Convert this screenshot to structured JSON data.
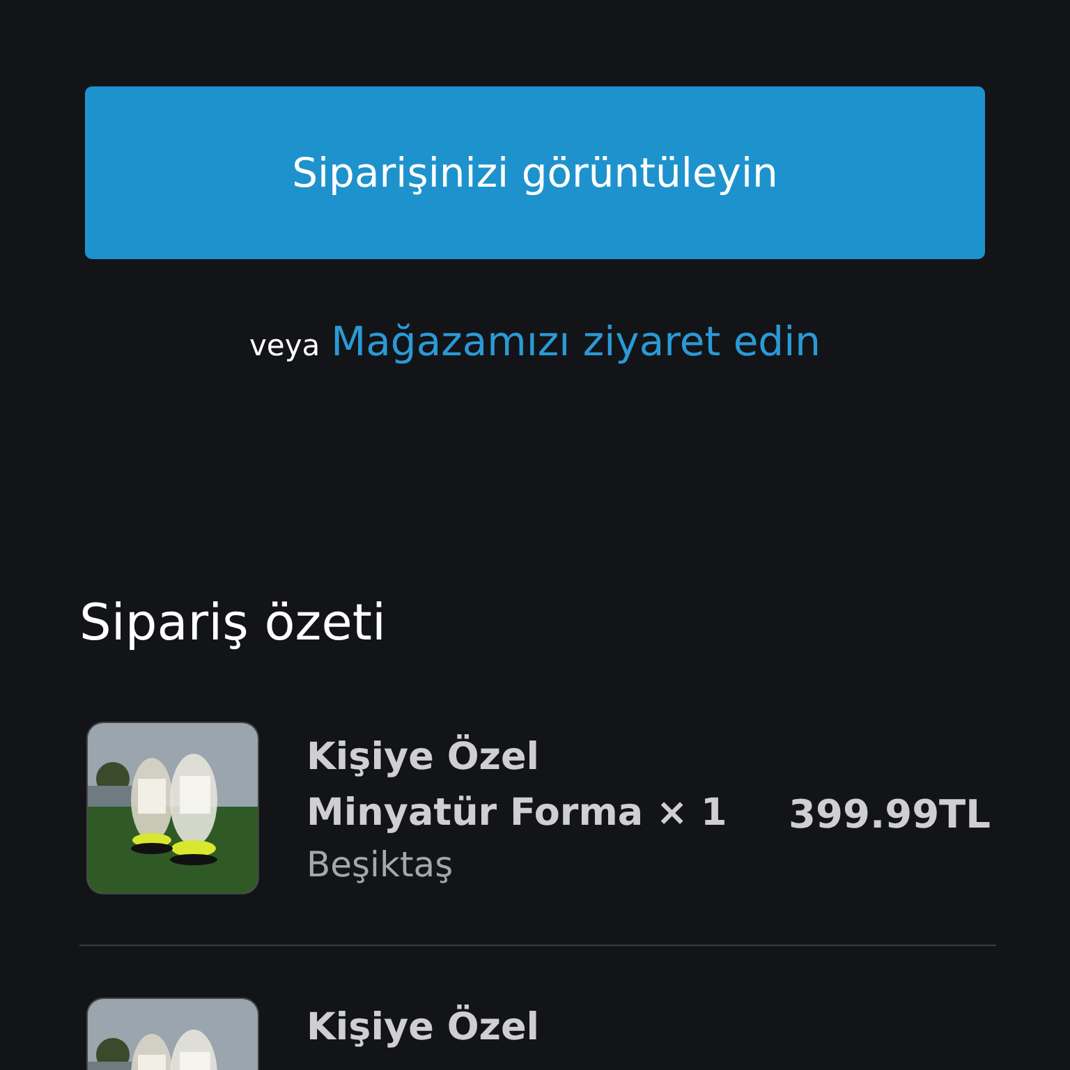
{
  "view_order_button": "Siparişinizi görüntüleyin",
  "alternative": {
    "prefix": "veya",
    "link": "Mağazamızı ziyaret edin"
  },
  "summary": {
    "title": "Sipariş özeti",
    "items": [
      {
        "kind": "picture",
        "name_line_1": "Kişiye Özel",
        "name_line_2": "Minyatür Forma × 1",
        "variant": "Beşiktaş",
        "price": "399.99TL"
      },
      {
        "kind": "picture",
        "name_line_1": "Kişiye Özel"
      }
    ]
  }
}
